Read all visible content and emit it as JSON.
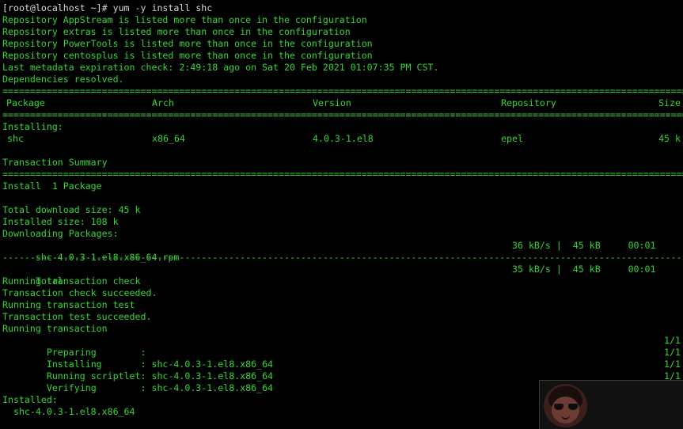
{
  "terminal": {
    "prompt": "[root@localhost ~]# yum -y install shc",
    "repo_warnings": [
      "Repository AppStream is listed more than once in the configuration",
      "Repository extras is listed more than once in the configuration",
      "Repository PowerTools is listed more than once in the configuration",
      "Repository centosplus is listed more than once in the configuration"
    ],
    "metadata_line": "Last metadata expiration check: 2:49:18 ago on Sat 20 Feb 2021 01:07:35 PM CST.",
    "deps_line": "Dependencies resolved.",
    "separator_double": "==========================================================================================================================================================================",
    "separator_dashed": "--------------------------------------------------------------------------------------------------------------------------------------------------------------------------",
    "table": {
      "headers": {
        "package": "Package",
        "arch": "Arch",
        "version": "Version",
        "repository": "Repository",
        "size": "Size"
      },
      "section_label": "Installing:",
      "rows": [
        {
          "package": "shc",
          "arch": "x86_64",
          "version": "4.0.3-1.el8",
          "repository": "epel",
          "size": "45 k"
        }
      ]
    },
    "summary_title": "Transaction Summary",
    "install_count": "Install  1 Package",
    "total_download": "Total download size: 45 k",
    "installed_size": "Installed size: 108 k",
    "downloading": "Downloading Packages:",
    "download_file": {
      "name": "shc-4.0.3-1.el8.x86_64.rpm",
      "stats": "36 kB/s |  45 kB     00:01"
    },
    "total": {
      "label": "Total",
      "stats": "35 kB/s |  45 kB     00:01"
    },
    "transaction_lines": [
      "Running transaction check",
      "Transaction check succeeded.",
      "Running transaction test",
      "Transaction test succeeded.",
      "Running transaction"
    ],
    "steps": [
      {
        "label": "  Preparing        :",
        "count": "1/1"
      },
      {
        "label": "  Installing       : shc-4.0.3-1.el8.x86_64",
        "count": "1/1"
      },
      {
        "label": "  Running scriptlet: shc-4.0.3-1.el8.x86_64",
        "count": "1/1"
      },
      {
        "label": "  Verifying        : shc-4.0.3-1.el8.x86_64",
        "count": "1/1"
      }
    ],
    "installed_label": "Installed:",
    "installed_package": "  shc-4.0.3-1.el8.x86_64"
  },
  "watermark": {
    "icon": "avatar-icon"
  },
  "colors": {
    "background": "#000000",
    "text_green": "#33d633",
    "prompt_text": "#d7d7d7"
  }
}
